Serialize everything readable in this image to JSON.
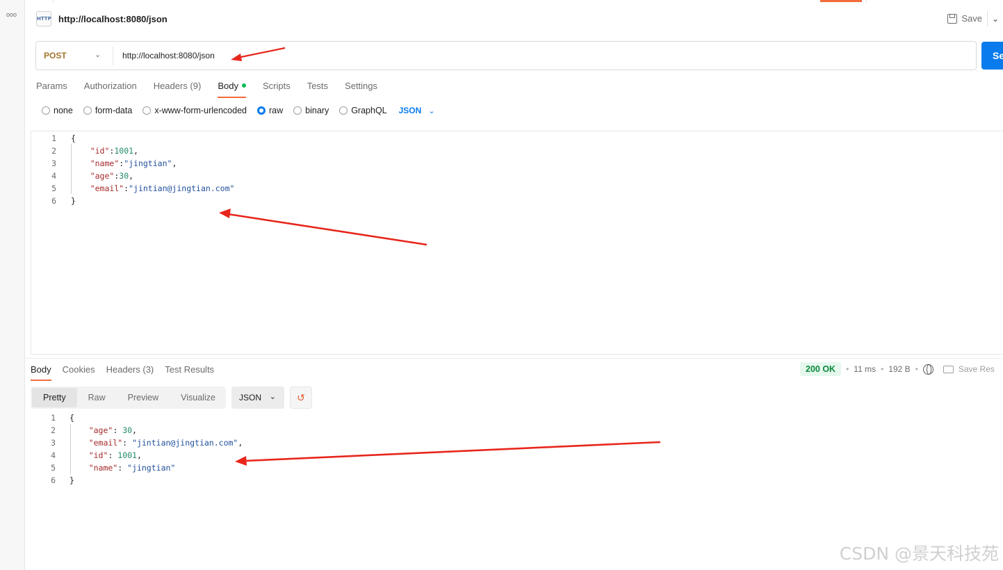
{
  "window": {
    "menu_dots": "ooo"
  },
  "header": {
    "icon_label": "HTTP",
    "title": "http://localhost:8080/json",
    "save_label": "Save"
  },
  "request": {
    "method": "POST",
    "url": "http://localhost:8080/json",
    "send_label": "Send"
  },
  "request_tabs": [
    {
      "label": "Params"
    },
    {
      "label": "Authorization"
    },
    {
      "label": "Headers (9)"
    },
    {
      "label": "Body",
      "active": true
    },
    {
      "label": "Scripts"
    },
    {
      "label": "Tests"
    },
    {
      "label": "Settings"
    }
  ],
  "body_types": [
    {
      "label": "none",
      "checked": false
    },
    {
      "label": "form-data",
      "checked": false
    },
    {
      "label": "x-www-form-urlencoded",
      "checked": false
    },
    {
      "label": "raw",
      "checked": true
    },
    {
      "label": "binary",
      "checked": false
    },
    {
      "label": "GraphQL",
      "checked": false
    }
  ],
  "body_language": "JSON",
  "request_body_lines": [
    {
      "n": "1",
      "text": "{"
    },
    {
      "n": "2",
      "key": "\"id\"",
      "sep": ":",
      "val": "1001",
      "val_type": "n",
      "tail": ","
    },
    {
      "n": "3",
      "key": "\"name\"",
      "sep": ":",
      "val": "\"jingtian\"",
      "val_type": "s",
      "tail": ","
    },
    {
      "n": "4",
      "key": "\"age\"",
      "sep": ":",
      "val": "30",
      "val_type": "n",
      "tail": ","
    },
    {
      "n": "5",
      "key": "\"email\"",
      "sep": ":",
      "val": "\"jintian@jingtian.com\"",
      "val_type": "s",
      "tail": ""
    },
    {
      "n": "6",
      "text": "}"
    }
  ],
  "response_tabs": [
    {
      "label": "Body",
      "active": true
    },
    {
      "label": "Cookies"
    },
    {
      "label": "Headers (3)"
    },
    {
      "label": "Test Results"
    }
  ],
  "response_meta": {
    "status": "200 OK",
    "time": "11 ms",
    "size": "192 B",
    "save_response_label": "Save Res"
  },
  "response_views": [
    {
      "label": "Pretty",
      "active": true
    },
    {
      "label": "Raw"
    },
    {
      "label": "Preview"
    },
    {
      "label": "Visualize"
    }
  ],
  "response_language": "JSON",
  "response_body_lines": [
    {
      "n": "1",
      "text": "{"
    },
    {
      "n": "2",
      "key": "\"age\"",
      "sep": ": ",
      "val": "30",
      "val_type": "n",
      "tail": ","
    },
    {
      "n": "3",
      "key": "\"email\"",
      "sep": ": ",
      "val": "\"jintian@jingtian.com\"",
      "val_type": "s",
      "tail": ","
    },
    {
      "n": "4",
      "key": "\"id\"",
      "sep": ": ",
      "val": "1001",
      "val_type": "n",
      "tail": ","
    },
    {
      "n": "5",
      "key": "\"name\"",
      "sep": ": ",
      "val": "\"jingtian\"",
      "val_type": "s",
      "tail": ""
    },
    {
      "n": "6",
      "text": "}"
    }
  ],
  "watermark": "CSDN @景天科技苑",
  "colors": {
    "accent_orange": "#f26b3a",
    "send_blue": "#097bed",
    "method_post": "#a3762b",
    "status_ok": "#0a8a3c",
    "annotation_arrow": "#e8261c"
  }
}
